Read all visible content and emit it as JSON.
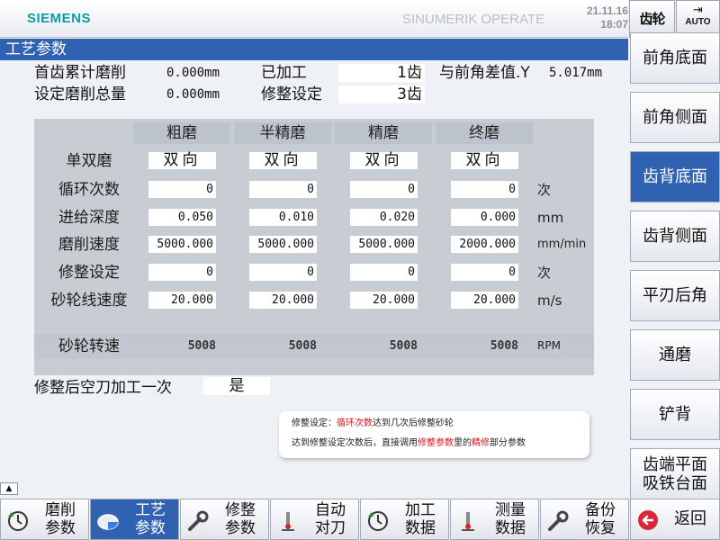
{
  "header": {
    "brand": "SIEMENS",
    "app": "SINUMERIK OPERATE",
    "date": "21.11.16",
    "time": "18:07",
    "channel_label": "齿轮",
    "mode": "AUTO"
  },
  "page_title": "工艺参数",
  "summary": {
    "total_grind_label": "首齿累计磨削",
    "total_grind_value": "0.000mm",
    "set_grind_label": "设定磨削总量",
    "set_grind_value": "0.000mm",
    "processed_label": "已加工",
    "processed_value": "1齿",
    "dress_label": "修整设定",
    "dress_value": "3齿",
    "rake_diff_label": "与前角差值.Y",
    "rake_diff_value": "5.017mm"
  },
  "table": {
    "columns": [
      "粗磨",
      "半精磨",
      "精磨",
      "终磨"
    ],
    "rows": [
      {
        "label": "单双磨",
        "values": [
          "双向",
          "双向",
          "双向",
          "双向"
        ],
        "unit": ""
      },
      {
        "label": "循环次数",
        "values": [
          "0",
          "0",
          "0",
          "0"
        ],
        "unit": "次"
      },
      {
        "label": "进给深度",
        "values": [
          "0.050",
          "0.010",
          "0.020",
          "0.000"
        ],
        "unit": "mm"
      },
      {
        "label": "磨削速度",
        "values": [
          "5000.000",
          "5000.000",
          "5000.000",
          "2000.000"
        ],
        "unit": "mm/min"
      },
      {
        "label": "修整设定",
        "values": [
          "0",
          "0",
          "0",
          "0"
        ],
        "unit": "次"
      },
      {
        "label": "砂轮线速度",
        "values": [
          "20.000",
          "20.000",
          "20.000",
          "20.000"
        ],
        "unit": "m/s"
      }
    ],
    "rpm_row": {
      "label": "砂轮转速",
      "values": [
        "5008",
        "5008",
        "5008",
        "5008"
      ],
      "unit": "RPM"
    }
  },
  "dress_empty_cut": {
    "label": "修整后空刀加工一次",
    "value": "是"
  },
  "note": {
    "line1_prefix": "修整设定：",
    "line1_highlight": "循环次数",
    "line1_suffix": "达到几次后修整砂轮",
    "line2_a": "达到修整设定次数后，直接调用",
    "line2_highlight1": "修整参数",
    "line2_b": "里的",
    "line2_highlight2": "精修",
    "line2_c": "部分参数"
  },
  "right_softkeys": [
    {
      "line1": "前角底面",
      "line2": ""
    },
    {
      "line1": "前角侧面",
      "line2": ""
    },
    {
      "line1": "齿背底面",
      "line2": ""
    },
    {
      "line1": "齿背侧面",
      "line2": ""
    },
    {
      "line1": "平刃后角",
      "line2": ""
    },
    {
      "line1": "通磨",
      "line2": ""
    },
    {
      "line1": "铲背",
      "line2": ""
    },
    {
      "line1": "齿端平面",
      "line2": "吸铁台面"
    }
  ],
  "bottom_softkeys": [
    {
      "line1": "磨削",
      "line2": "参数",
      "icon": "clock-arrow-icon"
    },
    {
      "line1": "工艺",
      "line2": "参数",
      "icon": "pie-icon"
    },
    {
      "line1": "修整",
      "line2": "参数",
      "icon": "wrench-icon"
    },
    {
      "line1": "自动",
      "line2": "对刀",
      "icon": "probe-icon"
    },
    {
      "line1": "加工",
      "line2": "数据",
      "icon": "clock-arrow-icon"
    },
    {
      "line1": "测量",
      "line2": "数据",
      "icon": "probe-icon"
    },
    {
      "line1": "备份",
      "line2": "恢复",
      "icon": "wrench-icon"
    },
    {
      "line1": "返回",
      "line2": "",
      "icon": "back-arrow-icon"
    }
  ],
  "colors": {
    "accent": "#2f62b0",
    "highlight_text": "#d9141f",
    "brand": "#119aa1"
  }
}
